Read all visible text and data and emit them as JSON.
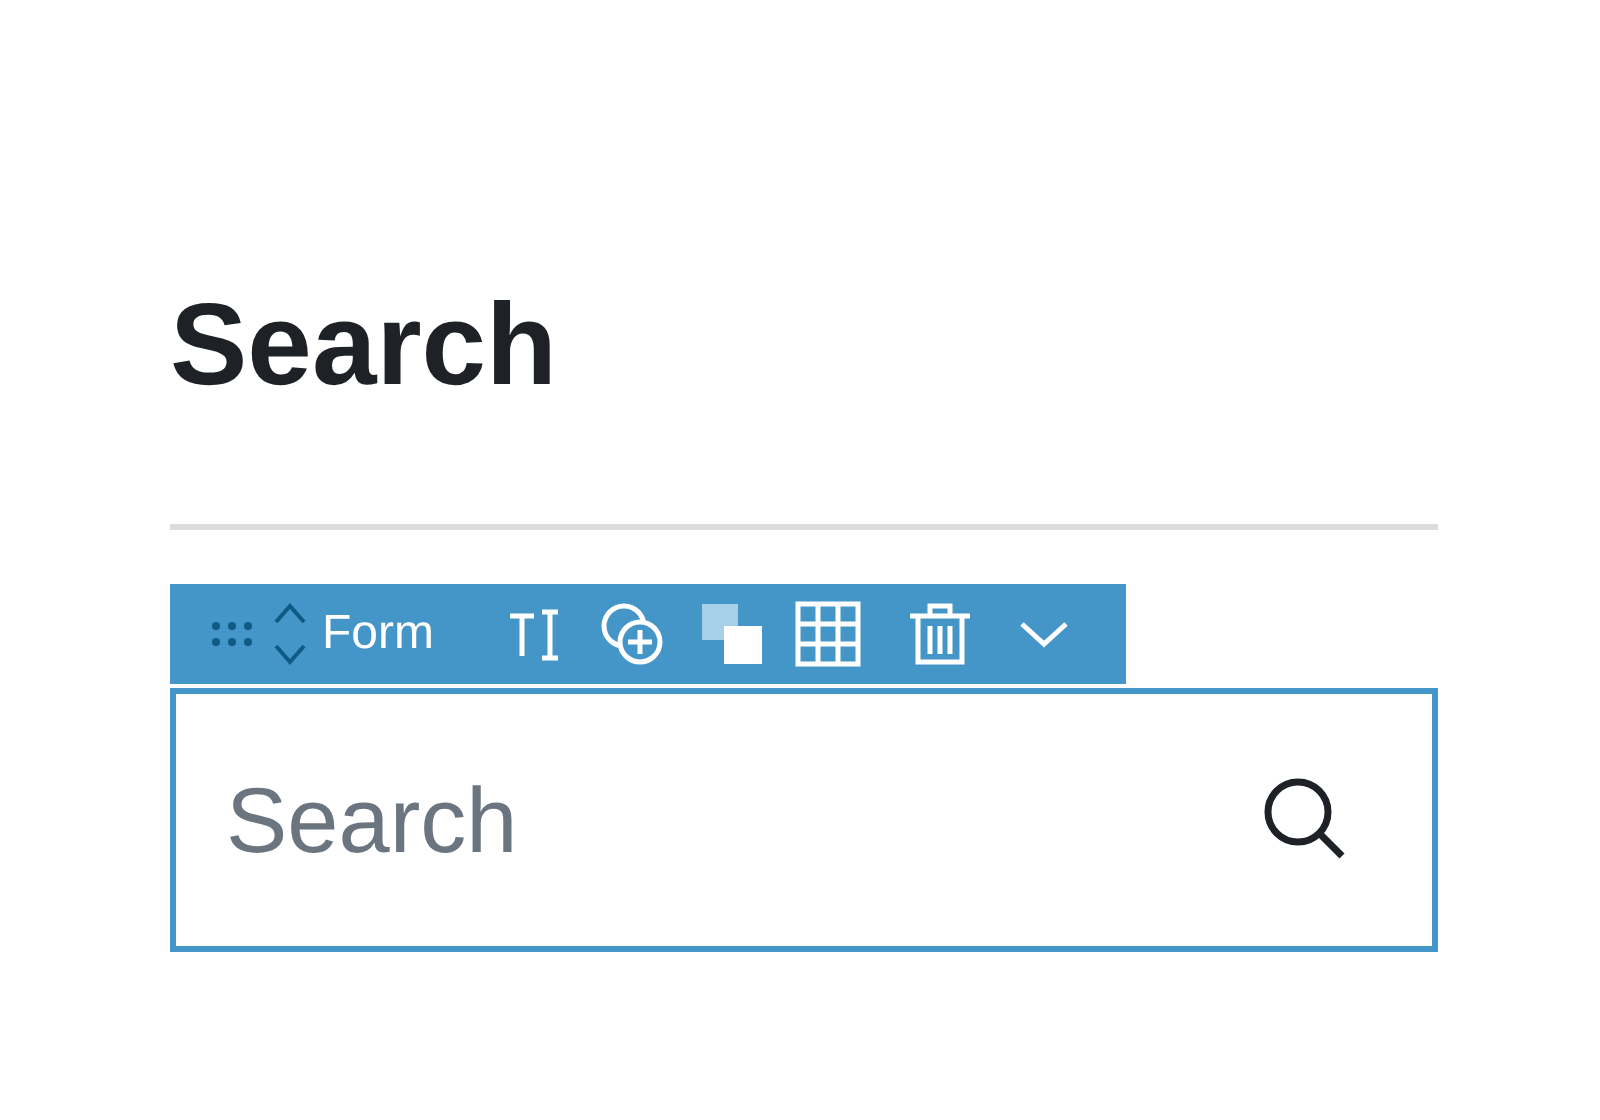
{
  "heading": "Search",
  "toolbar": {
    "block_label": "Form"
  },
  "search": {
    "placeholder": "Search"
  }
}
